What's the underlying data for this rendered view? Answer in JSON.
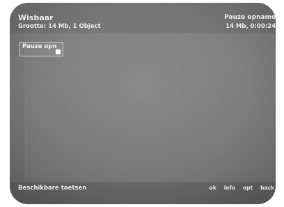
{
  "header": {
    "title": "Wisbaar",
    "subtitle": "Grootte: 14 Mb, 1 Object",
    "right_title": "Pauze opname",
    "right_info": "14 Mb, 0:00:24"
  },
  "items": [
    {
      "label": "Pauze opn",
      "icon": "stop-square-icon"
    }
  ],
  "footer": {
    "label": "Beschikbare toetsen",
    "keys": [
      "ok",
      "info",
      "opt",
      "back"
    ]
  },
  "colors": {
    "background": "#7b7b7b",
    "text": "#f3f3f3"
  }
}
